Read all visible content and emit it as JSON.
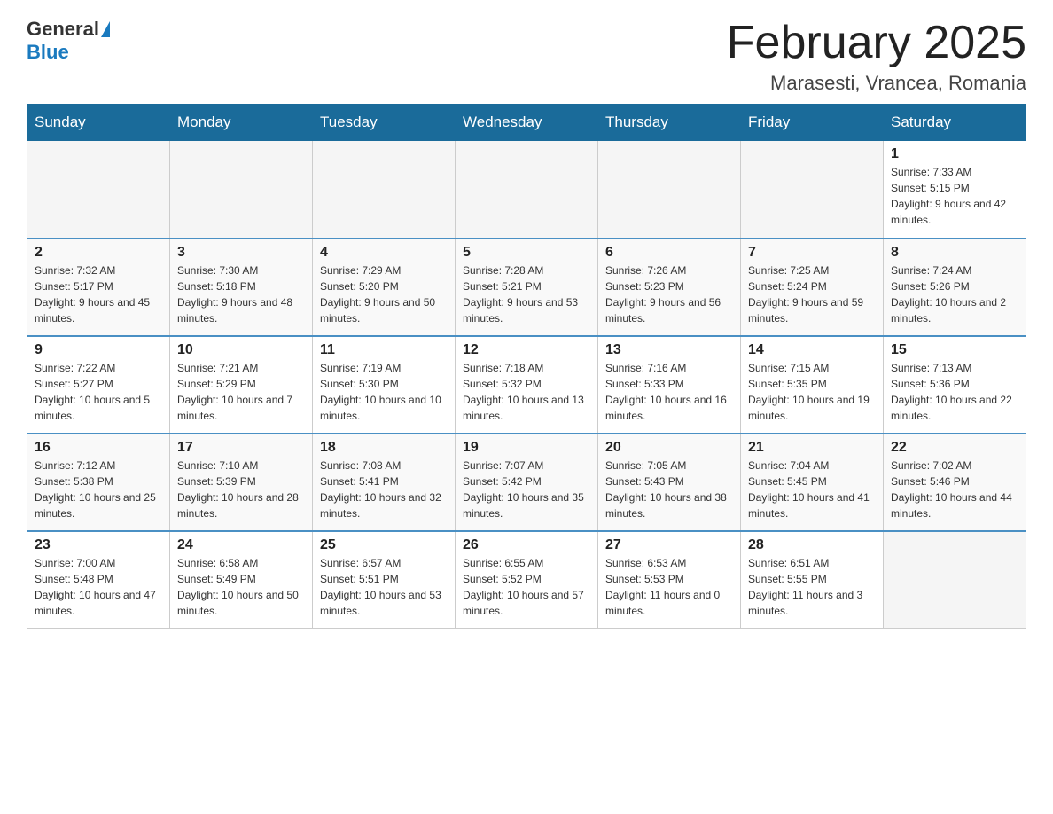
{
  "header": {
    "logo": {
      "general": "General",
      "blue": "Blue"
    },
    "title": "February 2025",
    "location": "Marasesti, Vrancea, Romania"
  },
  "days_of_week": [
    "Sunday",
    "Monday",
    "Tuesday",
    "Wednesday",
    "Thursday",
    "Friday",
    "Saturday"
  ],
  "weeks": [
    [
      {
        "day": "",
        "info": ""
      },
      {
        "day": "",
        "info": ""
      },
      {
        "day": "",
        "info": ""
      },
      {
        "day": "",
        "info": ""
      },
      {
        "day": "",
        "info": ""
      },
      {
        "day": "",
        "info": ""
      },
      {
        "day": "1",
        "info": "Sunrise: 7:33 AM\nSunset: 5:15 PM\nDaylight: 9 hours and 42 minutes."
      }
    ],
    [
      {
        "day": "2",
        "info": "Sunrise: 7:32 AM\nSunset: 5:17 PM\nDaylight: 9 hours and 45 minutes."
      },
      {
        "day": "3",
        "info": "Sunrise: 7:30 AM\nSunset: 5:18 PM\nDaylight: 9 hours and 48 minutes."
      },
      {
        "day": "4",
        "info": "Sunrise: 7:29 AM\nSunset: 5:20 PM\nDaylight: 9 hours and 50 minutes."
      },
      {
        "day": "5",
        "info": "Sunrise: 7:28 AM\nSunset: 5:21 PM\nDaylight: 9 hours and 53 minutes."
      },
      {
        "day": "6",
        "info": "Sunrise: 7:26 AM\nSunset: 5:23 PM\nDaylight: 9 hours and 56 minutes."
      },
      {
        "day": "7",
        "info": "Sunrise: 7:25 AM\nSunset: 5:24 PM\nDaylight: 9 hours and 59 minutes."
      },
      {
        "day": "8",
        "info": "Sunrise: 7:24 AM\nSunset: 5:26 PM\nDaylight: 10 hours and 2 minutes."
      }
    ],
    [
      {
        "day": "9",
        "info": "Sunrise: 7:22 AM\nSunset: 5:27 PM\nDaylight: 10 hours and 5 minutes."
      },
      {
        "day": "10",
        "info": "Sunrise: 7:21 AM\nSunset: 5:29 PM\nDaylight: 10 hours and 7 minutes."
      },
      {
        "day": "11",
        "info": "Sunrise: 7:19 AM\nSunset: 5:30 PM\nDaylight: 10 hours and 10 minutes."
      },
      {
        "day": "12",
        "info": "Sunrise: 7:18 AM\nSunset: 5:32 PM\nDaylight: 10 hours and 13 minutes."
      },
      {
        "day": "13",
        "info": "Sunrise: 7:16 AM\nSunset: 5:33 PM\nDaylight: 10 hours and 16 minutes."
      },
      {
        "day": "14",
        "info": "Sunrise: 7:15 AM\nSunset: 5:35 PM\nDaylight: 10 hours and 19 minutes."
      },
      {
        "day": "15",
        "info": "Sunrise: 7:13 AM\nSunset: 5:36 PM\nDaylight: 10 hours and 22 minutes."
      }
    ],
    [
      {
        "day": "16",
        "info": "Sunrise: 7:12 AM\nSunset: 5:38 PM\nDaylight: 10 hours and 25 minutes."
      },
      {
        "day": "17",
        "info": "Sunrise: 7:10 AM\nSunset: 5:39 PM\nDaylight: 10 hours and 28 minutes."
      },
      {
        "day": "18",
        "info": "Sunrise: 7:08 AM\nSunset: 5:41 PM\nDaylight: 10 hours and 32 minutes."
      },
      {
        "day": "19",
        "info": "Sunrise: 7:07 AM\nSunset: 5:42 PM\nDaylight: 10 hours and 35 minutes."
      },
      {
        "day": "20",
        "info": "Sunrise: 7:05 AM\nSunset: 5:43 PM\nDaylight: 10 hours and 38 minutes."
      },
      {
        "day": "21",
        "info": "Sunrise: 7:04 AM\nSunset: 5:45 PM\nDaylight: 10 hours and 41 minutes."
      },
      {
        "day": "22",
        "info": "Sunrise: 7:02 AM\nSunset: 5:46 PM\nDaylight: 10 hours and 44 minutes."
      }
    ],
    [
      {
        "day": "23",
        "info": "Sunrise: 7:00 AM\nSunset: 5:48 PM\nDaylight: 10 hours and 47 minutes."
      },
      {
        "day": "24",
        "info": "Sunrise: 6:58 AM\nSunset: 5:49 PM\nDaylight: 10 hours and 50 minutes."
      },
      {
        "day": "25",
        "info": "Sunrise: 6:57 AM\nSunset: 5:51 PM\nDaylight: 10 hours and 53 minutes."
      },
      {
        "day": "26",
        "info": "Sunrise: 6:55 AM\nSunset: 5:52 PM\nDaylight: 10 hours and 57 minutes."
      },
      {
        "day": "27",
        "info": "Sunrise: 6:53 AM\nSunset: 5:53 PM\nDaylight: 11 hours and 0 minutes."
      },
      {
        "day": "28",
        "info": "Sunrise: 6:51 AM\nSunset: 5:55 PM\nDaylight: 11 hours and 3 minutes."
      },
      {
        "day": "",
        "info": ""
      }
    ]
  ]
}
